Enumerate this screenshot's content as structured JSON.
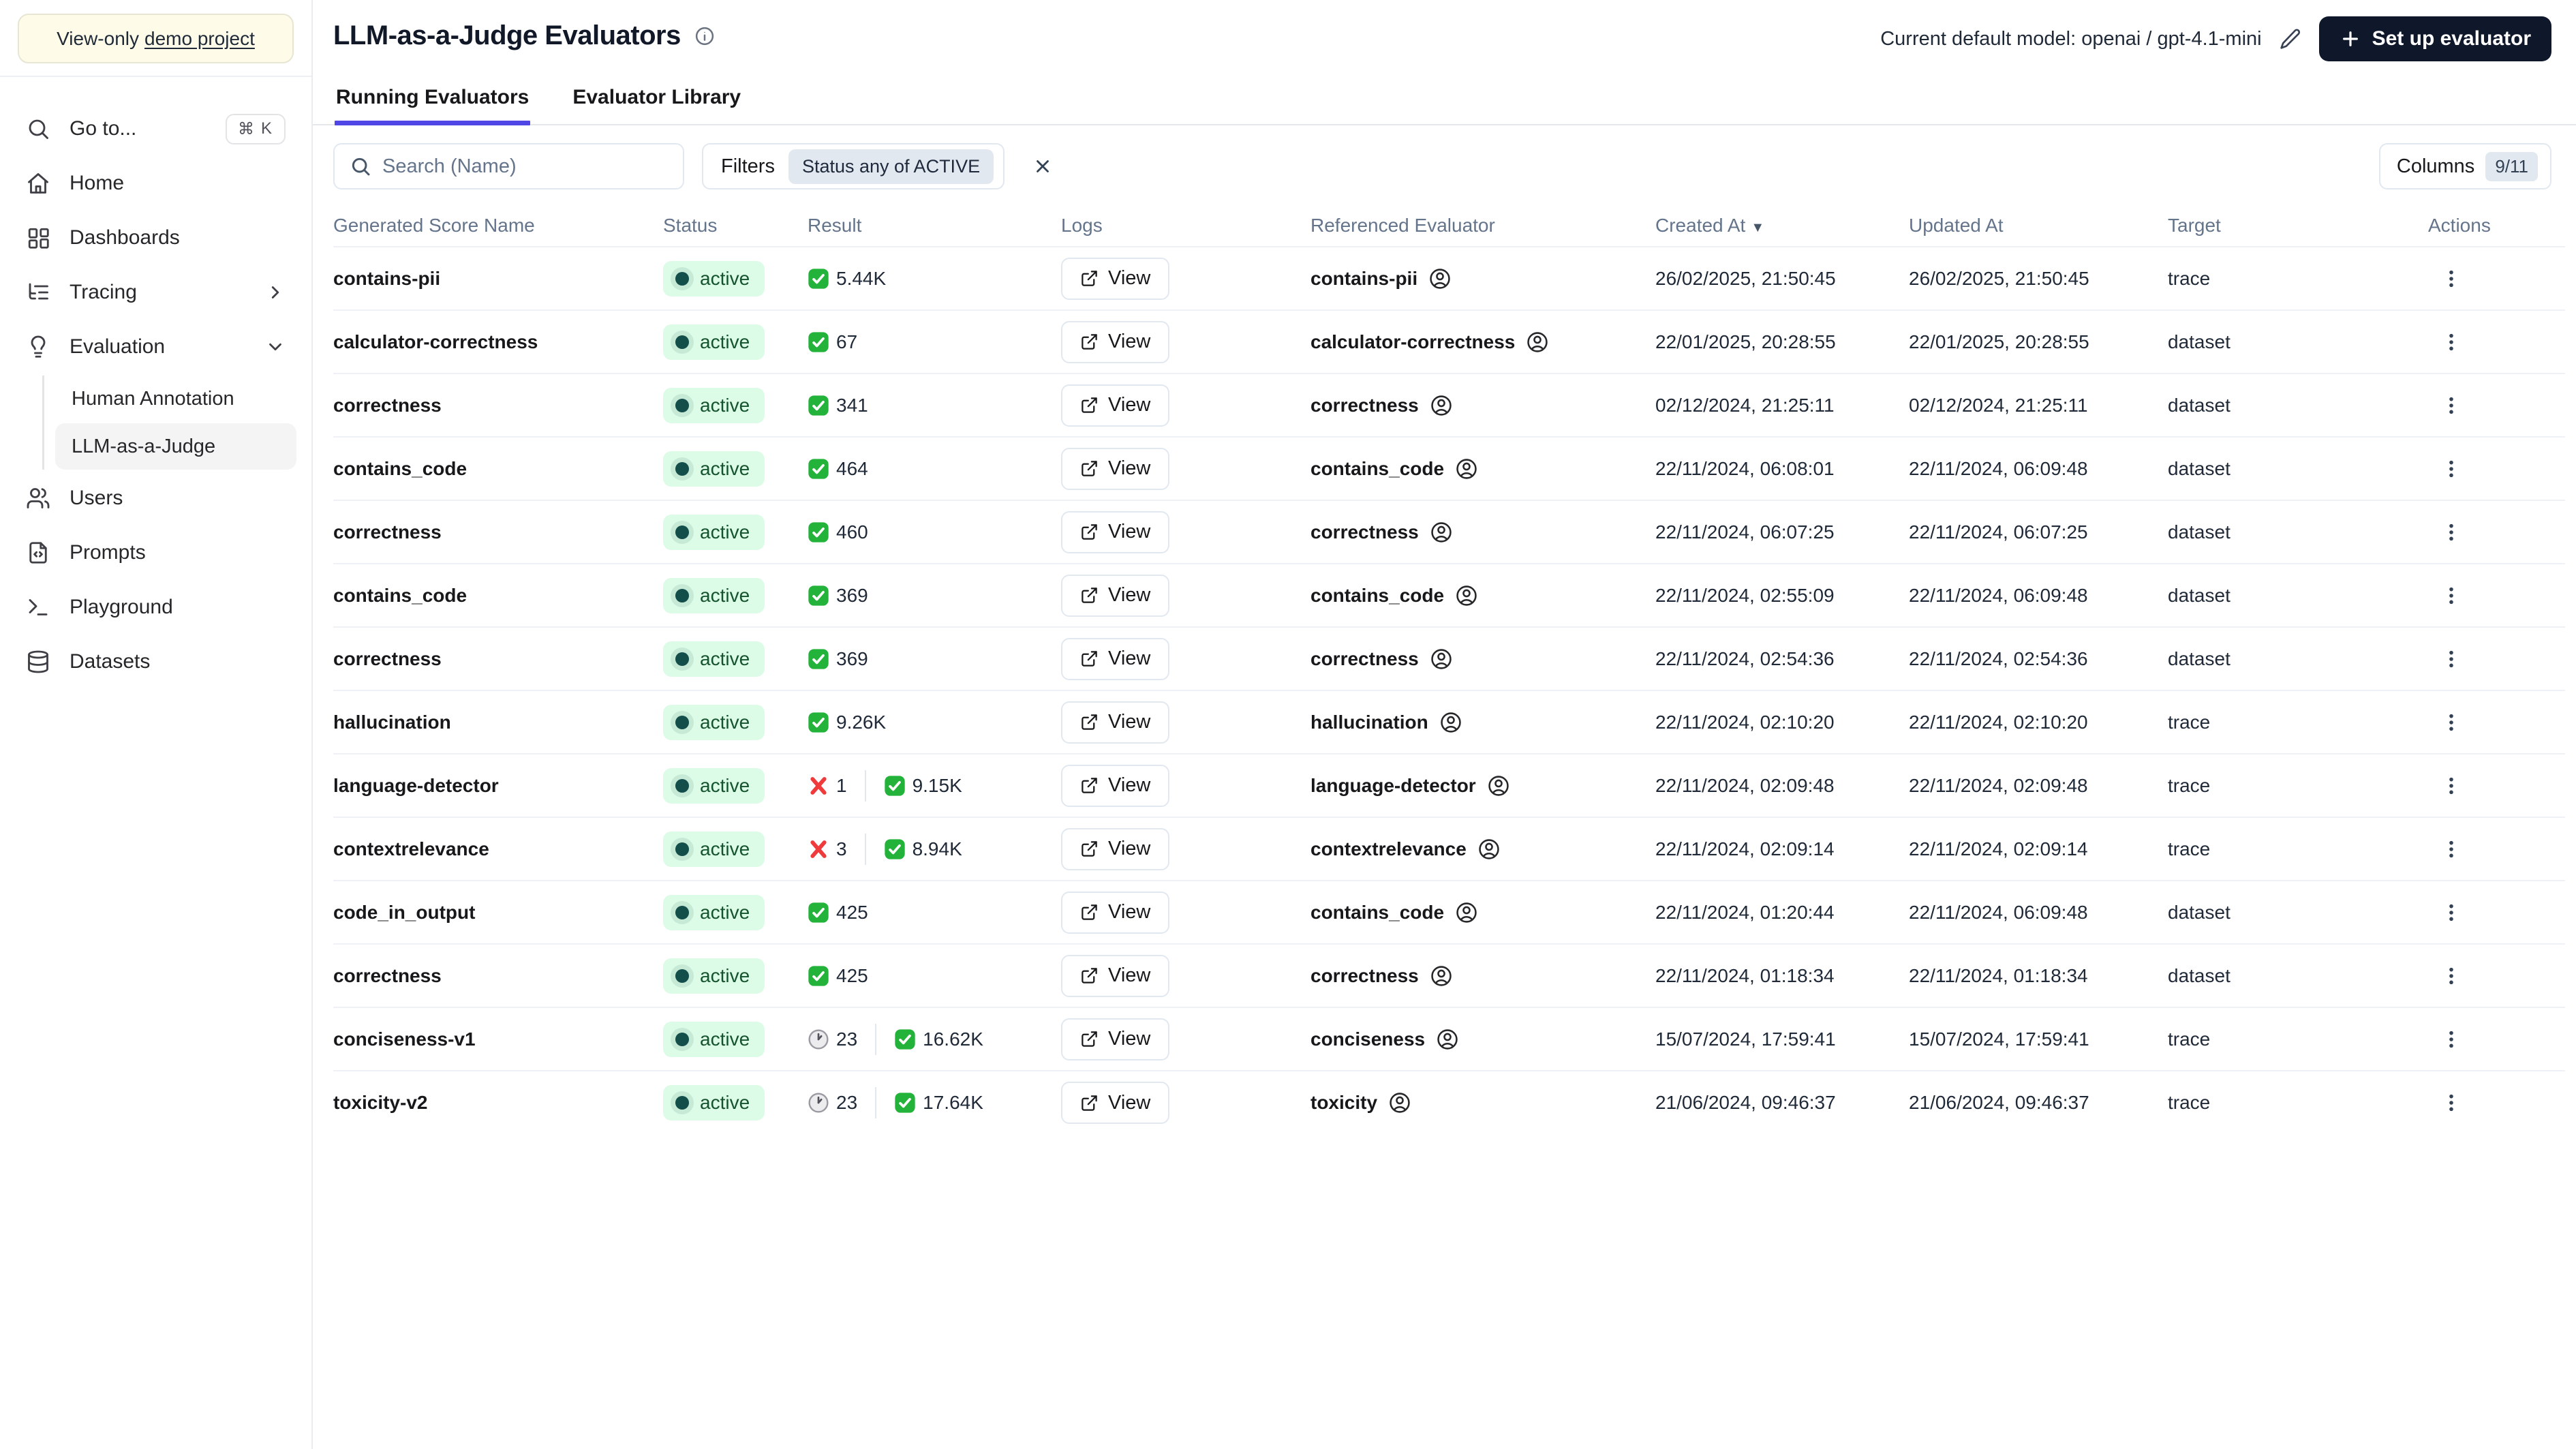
{
  "sidebar": {
    "banner": {
      "prefix": "View-only",
      "link": "demo project"
    },
    "go_to": {
      "label": "Go to...",
      "shortcut_mod": "⌘",
      "shortcut_key": "K"
    },
    "items": [
      {
        "label": "Home",
        "icon": "home-icon"
      },
      {
        "label": "Dashboards",
        "icon": "dashboards-icon"
      },
      {
        "label": "Tracing",
        "icon": "tracing-icon",
        "chevron": "right"
      },
      {
        "label": "Evaluation",
        "icon": "lightbulb-icon",
        "chevron": "down"
      }
    ],
    "evaluation_children": [
      {
        "label": "Human Annotation",
        "active": false
      },
      {
        "label": "LLM-as-a-Judge",
        "active": true
      }
    ],
    "items_bottom": [
      {
        "label": "Users",
        "icon": "users-icon"
      },
      {
        "label": "Prompts",
        "icon": "file-icon"
      },
      {
        "label": "Playground",
        "icon": "terminal-icon"
      },
      {
        "label": "Datasets",
        "icon": "database-icon"
      }
    ]
  },
  "header": {
    "title": "LLM-as-a-Judge Evaluators",
    "model_label": "Current default model: openai / gpt-4.1-mini",
    "setup_button_label": "Set up evaluator",
    "tabs": [
      {
        "label": "Running Evaluators",
        "active": true
      },
      {
        "label": "Evaluator Library",
        "active": false
      }
    ]
  },
  "toolbar": {
    "search_placeholder": "Search (Name)",
    "filters_label": "Filters",
    "filter_badge": "Status any of ACTIVE",
    "columns_label": "Columns",
    "columns_badge": "9/11"
  },
  "table": {
    "columns": [
      "Generated Score Name",
      "Status",
      "Result",
      "Logs",
      "Referenced Evaluator",
      "Created At",
      "Updated At",
      "Target",
      "Actions"
    ],
    "sorted_column": "Created At",
    "sort_direction": "desc",
    "view_label": "View",
    "rows": [
      {
        "name": "contains-pii",
        "status": "active",
        "result": {
          "success": "5.44K"
        },
        "referenced": "contains-pii",
        "created": "26/02/2025, 21:50:45",
        "updated": "26/02/2025, 21:50:45",
        "target": "trace"
      },
      {
        "name": "calculator-correctness",
        "status": "active",
        "result": {
          "success": "67"
        },
        "referenced": "calculator-correctness",
        "created": "22/01/2025, 20:28:55",
        "updated": "22/01/2025, 20:28:55",
        "target": "dataset"
      },
      {
        "name": "correctness",
        "status": "active",
        "result": {
          "success": "341"
        },
        "referenced": "correctness",
        "created": "02/12/2024, 21:25:11",
        "updated": "02/12/2024, 21:25:11",
        "target": "dataset"
      },
      {
        "name": "contains_code",
        "status": "active",
        "result": {
          "success": "464"
        },
        "referenced": "contains_code",
        "created": "22/11/2024, 06:08:01",
        "updated": "22/11/2024, 06:09:48",
        "target": "dataset"
      },
      {
        "name": "correctness",
        "status": "active",
        "result": {
          "success": "460"
        },
        "referenced": "correctness",
        "created": "22/11/2024, 06:07:25",
        "updated": "22/11/2024, 06:07:25",
        "target": "dataset"
      },
      {
        "name": "contains_code",
        "status": "active",
        "result": {
          "success": "369"
        },
        "referenced": "contains_code",
        "created": "22/11/2024, 02:55:09",
        "updated": "22/11/2024, 06:09:48",
        "target": "dataset"
      },
      {
        "name": "correctness",
        "status": "active",
        "result": {
          "success": "369"
        },
        "referenced": "correctness",
        "created": "22/11/2024, 02:54:36",
        "updated": "22/11/2024, 02:54:36",
        "target": "dataset"
      },
      {
        "name": "hallucination",
        "status": "active",
        "result": {
          "success": "9.26K"
        },
        "referenced": "hallucination",
        "created": "22/11/2024, 02:10:20",
        "updated": "22/11/2024, 02:10:20",
        "target": "trace"
      },
      {
        "name": "language-detector",
        "status": "active",
        "result": {
          "error": "1",
          "success": "9.15K"
        },
        "referenced": "language-detector",
        "created": "22/11/2024, 02:09:48",
        "updated": "22/11/2024, 02:09:48",
        "target": "trace"
      },
      {
        "name": "contextrelevance",
        "status": "active",
        "result": {
          "error": "3",
          "success": "8.94K"
        },
        "referenced": "contextrelevance",
        "created": "22/11/2024, 02:09:14",
        "updated": "22/11/2024, 02:09:14",
        "target": "trace"
      },
      {
        "name": "code_in_output",
        "status": "active",
        "result": {
          "success": "425"
        },
        "referenced": "contains_code",
        "created": "22/11/2024, 01:20:44",
        "updated": "22/11/2024, 06:09:48",
        "target": "dataset"
      },
      {
        "name": "correctness",
        "status": "active",
        "result": {
          "success": "425"
        },
        "referenced": "correctness",
        "created": "22/11/2024, 01:18:34",
        "updated": "22/11/2024, 01:18:34",
        "target": "dataset"
      },
      {
        "name": "conciseness-v1",
        "status": "active",
        "result": {
          "pending": "23",
          "success": "16.62K"
        },
        "referenced": "conciseness",
        "created": "15/07/2024, 17:59:41",
        "updated": "15/07/2024, 17:59:41",
        "target": "trace"
      },
      {
        "name": "toxicity-v2",
        "status": "active",
        "result": {
          "pending": "23",
          "success": "17.64K"
        },
        "referenced": "toxicity",
        "created": "21/06/2024, 09:46:37",
        "updated": "21/06/2024, 09:46:37",
        "target": "trace"
      }
    ]
  },
  "colors": {
    "accent_indigo": "#4f46e5",
    "dark_button": "#0f172a",
    "status_bg": "#dcfce7",
    "status_text": "#14532d",
    "success_green": "#23b33a",
    "error_red": "#ef3b3b",
    "banner_bg": "#fefce8"
  }
}
